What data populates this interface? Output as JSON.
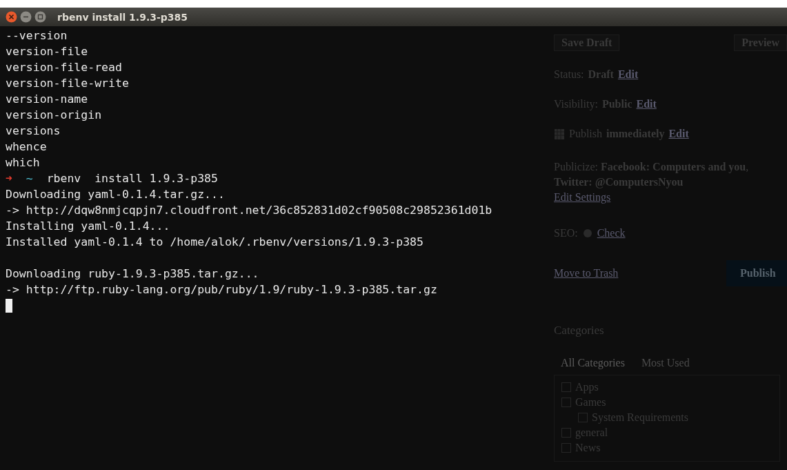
{
  "terminal": {
    "title": "rbenv install 1.9.3-p385",
    "lines": [
      {
        "kind": "output",
        "text": "--version"
      },
      {
        "kind": "output",
        "text": "version-file"
      },
      {
        "kind": "output",
        "text": "version-file-read"
      },
      {
        "kind": "output",
        "text": "version-file-write"
      },
      {
        "kind": "output",
        "text": "version-name"
      },
      {
        "kind": "output",
        "text": "version-origin"
      },
      {
        "kind": "output",
        "text": "versions"
      },
      {
        "kind": "output",
        "text": "whence"
      },
      {
        "kind": "output",
        "text": "which"
      },
      {
        "kind": "prompt",
        "arrow": "➜",
        "dir": "~",
        "text": "rbenv  install 1.9.3-p385"
      },
      {
        "kind": "output",
        "text": "Downloading yaml-0.1.4.tar.gz..."
      },
      {
        "kind": "output",
        "text": "-> http://dqw8nmjcqpjn7.cloudfront.net/36c852831d02cf90508c29852361d01b"
      },
      {
        "kind": "output",
        "text": "Installing yaml-0.1.4..."
      },
      {
        "kind": "output",
        "text": "Installed yaml-0.1.4 to /home/alok/.rbenv/versions/1.9.3-p385"
      },
      {
        "kind": "blank"
      },
      {
        "kind": "output",
        "text": "Downloading ruby-1.9.3-p385.tar.gz..."
      },
      {
        "kind": "output",
        "text": "-> http://ftp.ruby-lang.org/pub/ruby/1.9/ruby-1.9.3-p385.tar.gz"
      },
      {
        "kind": "cursor"
      }
    ]
  },
  "background_editor": {
    "buttons": [
      "Save Draft",
      "Preview"
    ],
    "status": [
      {
        "label": "Status:",
        "value": "Draft",
        "link": "Edit",
        "icon": false
      },
      {
        "label": "Visibility:",
        "value": "Public",
        "link": "Edit",
        "icon": false
      },
      {
        "label": "Publish",
        "value": "immediately",
        "link": "Edit",
        "icon": true
      }
    ],
    "publicize": {
      "text": "Publicize: **Facebook: Computers and you**, **Twitter: @ComputersNyou**",
      "link": "Edit Settings"
    },
    "seo": {
      "label": "SEO:",
      "link": "Check"
    },
    "trash_link": "Move to Trash",
    "publish_button": "Publish",
    "categories": {
      "title": "Categories",
      "tabs": [
        {
          "label": "All Categories",
          "selected": true
        },
        {
          "label": "Most Used",
          "selected": false
        }
      ],
      "items": [
        {
          "label": "Apps",
          "checked": false
        },
        {
          "label": "Games",
          "checked": false,
          "children": [
            {
              "label": "System Requirements",
              "checked": false
            }
          ]
        },
        {
          "label": "general",
          "checked": false
        },
        {
          "label": "News",
          "checked": false
        }
      ]
    }
  }
}
